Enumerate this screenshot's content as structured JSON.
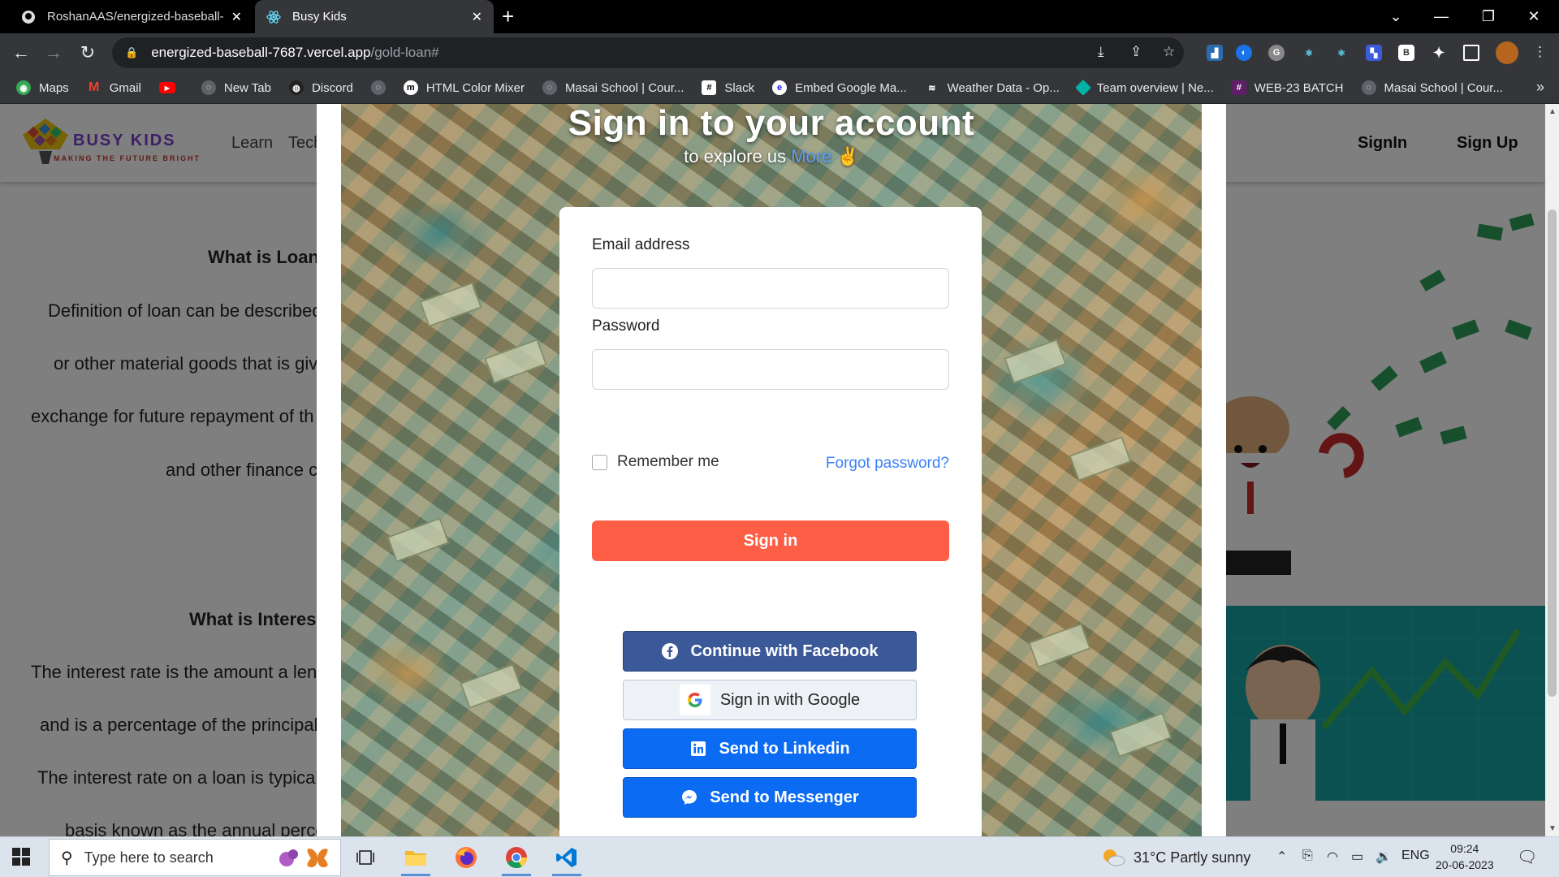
{
  "browser": {
    "tabs": [
      {
        "title": "RoshanAAS/energized-baseball-",
        "active": false
      },
      {
        "title": "Busy Kids",
        "active": true
      }
    ],
    "url_host": "energized-baseball-7687.vercel.app",
    "url_path": "/gold-loan#",
    "bookmarks": [
      {
        "label": "Maps",
        "icon": "maps-icon"
      },
      {
        "label": "Gmail",
        "icon": "gmail-icon"
      },
      {
        "label": "",
        "icon": "youtube-icon"
      },
      {
        "label": "New Tab",
        "icon": "globe-icon"
      },
      {
        "label": "Discord",
        "icon": "discord-icon"
      },
      {
        "label": "",
        "icon": "globe-icon"
      },
      {
        "label": "HTML Color Mixer",
        "icon": "m-icon"
      },
      {
        "label": "Masai School | Cour...",
        "icon": "globe-icon"
      },
      {
        "label": "Slack",
        "icon": "slack-icon"
      },
      {
        "label": "Embed Google Ma...",
        "icon": "embed-icon"
      },
      {
        "label": "Weather Data - Op...",
        "icon": "weather-icon"
      },
      {
        "label": "Team overview | Ne...",
        "icon": "diamond-icon"
      },
      {
        "label": "WEB-23 BATCH",
        "icon": "slack-icon"
      },
      {
        "label": "Masai School | Cour...",
        "icon": "globe-icon"
      }
    ]
  },
  "site": {
    "brand": "BUSY KIDS",
    "tagline": "MAKING THE FUTURE BRIGHT",
    "nav": {
      "learn": "Learn",
      "tech": "Tech",
      "signin": "SignIn",
      "signup": "Sign Up"
    }
  },
  "article": {
    "loan_heading": "What is Loan",
    "loan_lines": [
      "Definition of loan can be described",
      "or other material goods that is giv",
      "exchange for future repayment of th",
      "and other finance c"
    ],
    "interest_heading": "What is Interest",
    "interest_lines": [
      "The interest rate is the amount a len",
      "and is a percentage of the principal",
      "The interest rate on a loan is typical",
      "basis known as the annual perce"
    ]
  },
  "modal": {
    "title": "Sign in to your account",
    "subtitle": "to explore us",
    "subtitle_link": "More",
    "subtitle_emoji": "✌️",
    "email_label": "Email address",
    "password_label": "Password",
    "remember_label": "Remember me",
    "forgot_label": "Forgot password?",
    "signin_label": "Sign in",
    "facebook_label": "Continue with Facebook",
    "google_label": "Sign in with Google",
    "linkedin_label": "Send to Linkedin",
    "messenger_label": "Send to Messenger"
  },
  "taskbar": {
    "search_placeholder": "Type here to search",
    "weather": "31°C  Partly sunny",
    "lang": "ENG",
    "time": "09:24",
    "date": "20-06-2023"
  },
  "colors": {
    "signin_button": "#fd5e45",
    "facebook": "#3b5998",
    "linkedin": "#0b6bf2",
    "link": "#3b82f6"
  }
}
